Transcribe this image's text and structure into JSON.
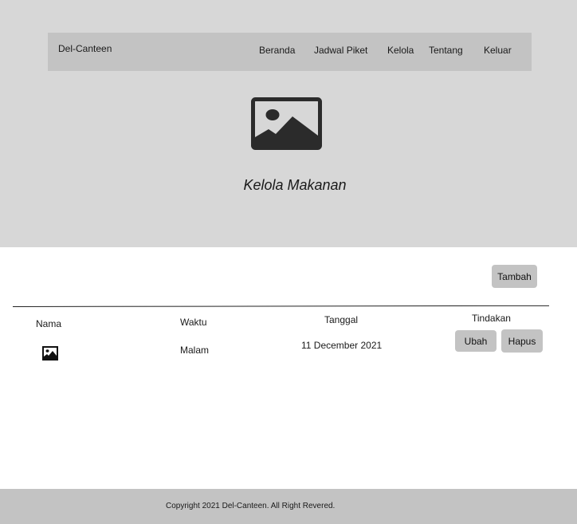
{
  "navbar": {
    "brand": "Del-Canteen",
    "items": [
      {
        "label": "Beranda"
      },
      {
        "label": "Jadwal Piket"
      },
      {
        "label": "Kelola"
      },
      {
        "label": "Tentang"
      },
      {
        "label": "Keluar"
      }
    ]
  },
  "hero": {
    "image_icon": "image-placeholder-icon",
    "title": "Kelola Makanan"
  },
  "toolbar": {
    "add_label": "Tambah"
  },
  "table": {
    "columns": [
      "Nama",
      "Waktu",
      "Tanggal",
      "Tindakan"
    ],
    "rows": [
      {
        "image_icon": "image-placeholder-icon",
        "waktu": "Malam",
        "tanggal": "11 December 2021",
        "edit_label": "Ubah",
        "delete_label": "Hapus"
      }
    ]
  },
  "footer": {
    "copyright": "Copyright 2021 Del-Canteen. All Right Revered."
  },
  "colors": {
    "hero_background": "#d7d7d7",
    "bar_background": "#c3c3c3",
    "icon_color": "#2b2b2b"
  }
}
